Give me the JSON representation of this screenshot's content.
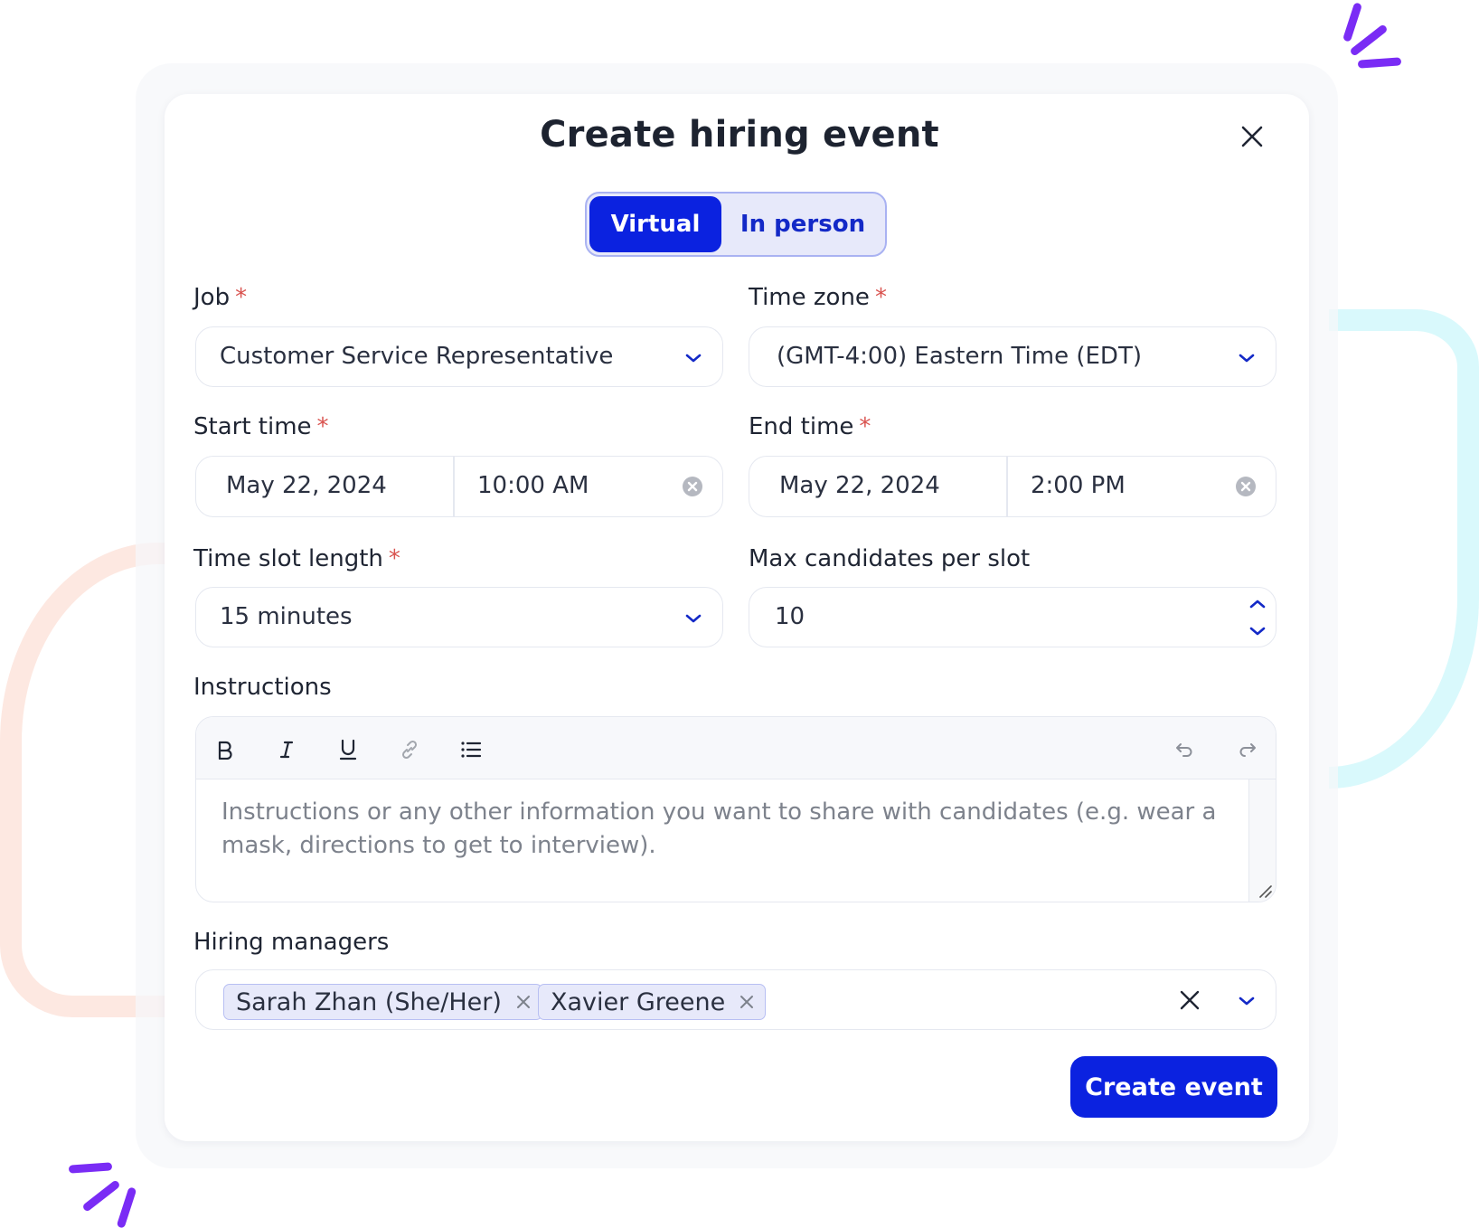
{
  "dialog": {
    "title": "Create hiring event",
    "close_icon": "close-icon"
  },
  "event_type": {
    "options": [
      "Virtual",
      "In person"
    ],
    "selected": "Virtual"
  },
  "colors": {
    "primary": "#0b22e0",
    "toggle_bg": "#e7e9fa",
    "required": "#d9534f",
    "spark": "#7a2cf5",
    "deco_peach": "#fde8e1",
    "deco_cyan": "#d9f9fc"
  },
  "fields": {
    "job": {
      "label": "Job",
      "required_marker": "*",
      "value": "Customer Service Representative"
    },
    "time_zone": {
      "label": "Time zone",
      "required_marker": "*",
      "value": "(GMT-4:00) Eastern Time (EDT)"
    },
    "start_time": {
      "label": "Start time",
      "required_marker": "*",
      "date": "May 22, 2024",
      "time": "10:00 AM"
    },
    "end_time": {
      "label": "End time",
      "required_marker": "*",
      "date": "May 22, 2024",
      "time": "2:00 PM"
    },
    "time_slot_length": {
      "label": "Time slot length",
      "required_marker": "*",
      "value": "15 minutes"
    },
    "max_candidates": {
      "label": "Max candidates per slot",
      "value": "10"
    },
    "instructions": {
      "label": "Instructions",
      "placeholder": "Instructions or any other information you want to share with candidates (e.g. wear a mask, directions to get to interview).",
      "toolbar": [
        "bold",
        "italic",
        "underline",
        "link",
        "bulleted-list",
        "undo",
        "redo"
      ]
    },
    "hiring_managers": {
      "label": "Hiring managers",
      "selected": [
        "Sarah Zhan (She/Her)",
        "Xavier Greene"
      ]
    }
  },
  "actions": {
    "create_label": "Create event"
  }
}
